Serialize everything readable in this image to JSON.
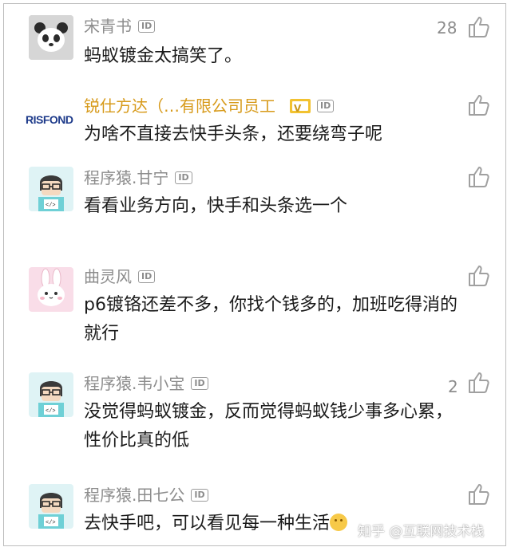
{
  "comments": [
    {
      "author": "宋青书",
      "id_badge": "ID",
      "text": "蚂蚁镀金太搞笑了。",
      "likes": "28",
      "avatar": "panda-avatar-icon"
    },
    {
      "author": "锐仕方达（…有限公司员工",
      "id_badge": "ID",
      "text": "为啥不直接去快手头条，还要绕弯子呢",
      "likes": "",
      "avatar": "risfond-logo",
      "avatar_text": "RISFOND",
      "verified_icon": "verified-badge-icon"
    },
    {
      "author": "程序猿.甘宁",
      "id_badge": "ID",
      "text": "看看业务方向，快手和头条选一个",
      "likes": "",
      "avatar": "programmer-avatar-icon"
    },
    {
      "author": "曲灵风",
      "id_badge": "ID",
      "text": "p6镀铬还差不多，你找个钱多的，加班吃得消的就行",
      "likes": "",
      "avatar": "rabbit-avatar-icon"
    },
    {
      "author": "程序猿.韦小宝",
      "id_badge": "ID",
      "text": "没觉得蚂蚁镀金，反而觉得蚂蚁钱少事多心累，性价比真的低",
      "likes": "2",
      "avatar": "programmer-avatar-icon"
    },
    {
      "author": "程序猿.田七公",
      "id_badge": "ID",
      "text": "去快手吧，可以看见每一种生活",
      "likes": "",
      "avatar": "programmer-avatar-icon"
    }
  ],
  "watermark": "知乎 @互联网技术栈",
  "like_icon": "thumbs-up-icon",
  "colors": {
    "name": "#8c8c8c",
    "name_org": "#d79a1a",
    "text": "#1a1a1a",
    "verified": "#f2c230"
  }
}
